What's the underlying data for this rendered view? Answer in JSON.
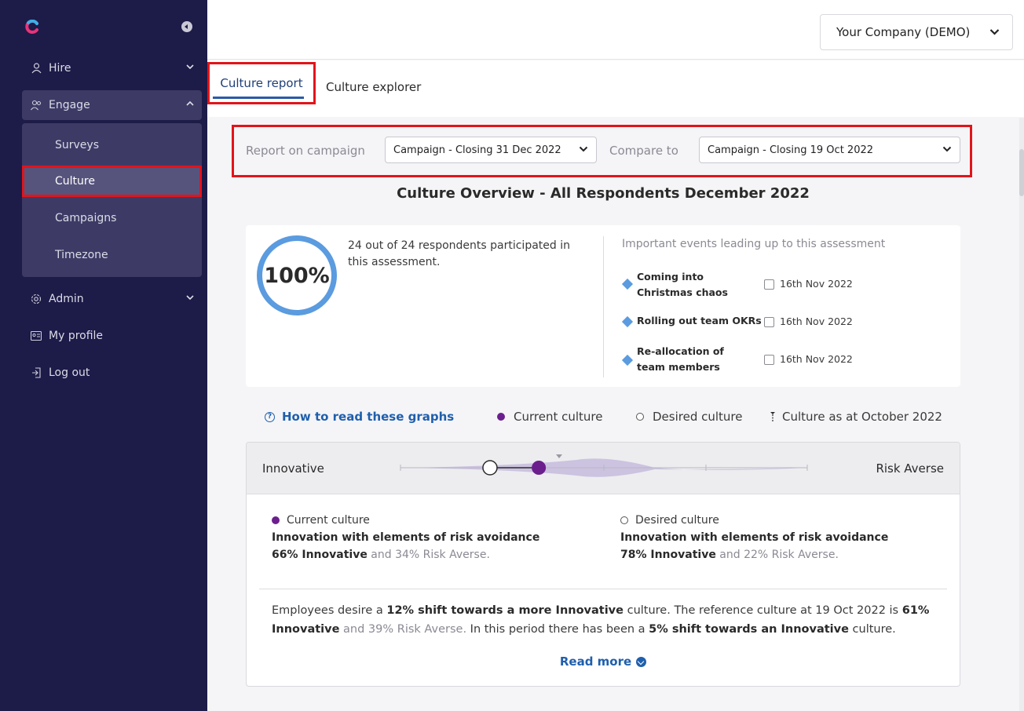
{
  "sidebar": {
    "logo_icon": "brand-logo-icon",
    "items": [
      {
        "label": "Hire",
        "icon": "person-icon"
      },
      {
        "label": "Engage",
        "icon": "people-icon"
      },
      {
        "label": "Admin",
        "icon": "gear-icon"
      },
      {
        "label": "My profile",
        "icon": "id-card-icon"
      },
      {
        "label": "Log out",
        "icon": "logout-icon"
      }
    ],
    "engage_subitems": [
      {
        "label": "Surveys"
      },
      {
        "label": "Culture"
      },
      {
        "label": "Campaigns"
      },
      {
        "label": "Timezone"
      }
    ]
  },
  "header": {
    "company_select": "Your Company (DEMO)"
  },
  "tabs": [
    {
      "label": "Culture report"
    },
    {
      "label": "Culture explorer"
    }
  ],
  "campaign_bar": {
    "report_label": "Report on campaign",
    "report_value": "Campaign - Closing 31 Dec 2022",
    "compare_label": "Compare to",
    "compare_value": "Campaign - Closing 19 Oct 2022"
  },
  "overview": {
    "title": "Culture Overview - All Respondents December 2022",
    "participation_percent": "100%",
    "participation_text": "24 out of 24 respondents participated in this assessment.",
    "events_title": "Important events leading up to this assessment",
    "events": [
      {
        "name": "Coming into Christmas chaos",
        "date": "16th Nov 2022"
      },
      {
        "name": "Rolling out team OKRs",
        "date": "16th Nov 2022"
      },
      {
        "name": "Re-allocation of team members",
        "date": "16th Nov 2022"
      }
    ]
  },
  "legend": {
    "howto": "How to read these graphs",
    "current": "Current culture",
    "desired": "Desired culture",
    "reference": "Culture as at October 2022"
  },
  "culture_card": {
    "left_label": "Innovative",
    "right_label": "Risk Averse",
    "current_percent_innovative": 66,
    "desired_percent_innovative": 78,
    "reference_percent_innovative": 61,
    "current": {
      "heading": "Current culture",
      "title": "Innovation with elements of risk avoidance",
      "strong": "66% Innovative",
      "rest": " and 34% Risk Averse."
    },
    "desired": {
      "heading": "Desired culture",
      "title": "Innovation with elements of risk avoidance",
      "strong": "78% Innovative",
      "rest": " and 22% Risk Averse."
    },
    "summary": {
      "p1": "Employees desire a ",
      "b1": "12% shift towards a more Innovative",
      "p2": " culture. The reference culture at 19 Oct 2022 is ",
      "b2": "61% Innovative",
      "p3": " and 39% Risk Averse.",
      "p4": " In this period there has been a ",
      "b3": "5% shift towards an Innovative",
      "p5": " culture."
    },
    "read_more": "Read more"
  },
  "colors": {
    "sidebar_bg": "#1d1b48",
    "accent_blue": "#1f5fad",
    "current_purple": "#6b1f8d",
    "highlight_red": "#e2141a"
  }
}
